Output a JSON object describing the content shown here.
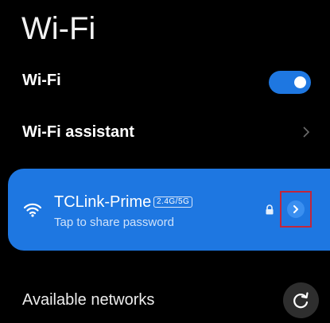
{
  "page": {
    "title": "Wi-Fi"
  },
  "wifi_row": {
    "label": "Wi-Fi",
    "enabled": true
  },
  "assistant_row": {
    "label": "Wi-Fi assistant",
    "icon": "chevron-right-icon"
  },
  "connected_network": {
    "name": "TCLink-Prime",
    "band": "2.4G/5G",
    "subtitle": "Tap to share password",
    "secured": true,
    "icons": [
      "wifi-signal-icon",
      "lock-icon",
      "chevron-right-icon"
    ]
  },
  "available": {
    "title": "Available networks",
    "refresh_icon": "refresh-icon"
  },
  "colors": {
    "accent": "#1e77e1",
    "background": "#000000",
    "highlight_box": "#c2263b"
  }
}
